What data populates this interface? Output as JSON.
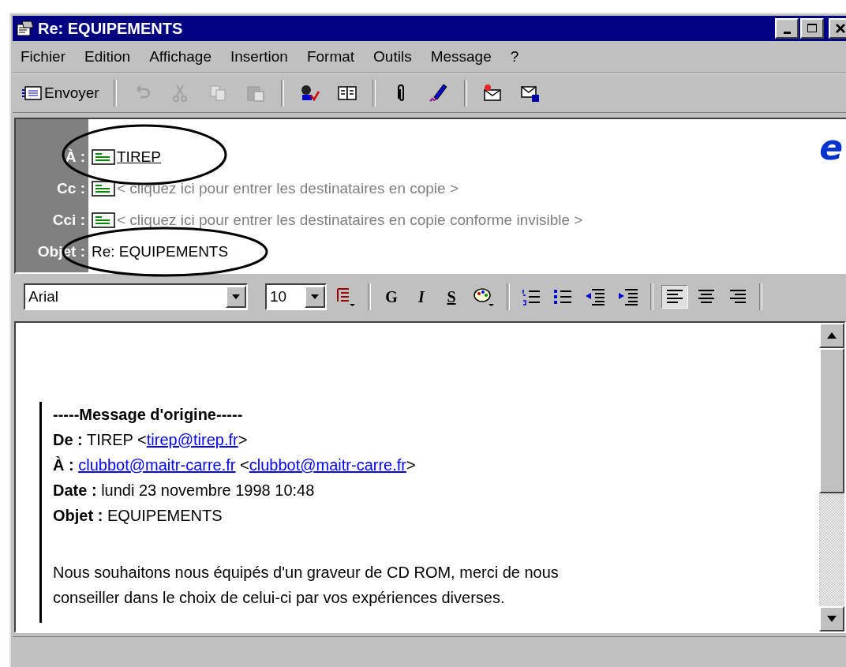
{
  "window": {
    "title": "Re: EQUIPEMENTS"
  },
  "menu": [
    {
      "label": "Fichier"
    },
    {
      "label": "Edition"
    },
    {
      "label": "Affichage"
    },
    {
      "label": "Insertion"
    },
    {
      "label": "Format"
    },
    {
      "label": "Outils"
    },
    {
      "label": "Message"
    },
    {
      "label": "?"
    }
  ],
  "toolbar": {
    "send": {
      "label": "Envoyer"
    },
    "buttons": [
      {
        "disabled": true
      },
      {
        "disabled": true
      },
      {
        "disabled": true
      },
      {
        "disabled": true
      },
      {
        "disabled": false
      },
      {
        "disabled": false
      },
      {
        "disabled": false
      },
      {
        "disabled": false
      },
      {
        "disabled": false
      },
      {
        "disabled": false
      }
    ]
  },
  "header": {
    "logo": "e",
    "to": {
      "label": "À :",
      "value": "TIREP"
    },
    "cc": {
      "label": "Cc :",
      "placeholder": "< cliquez ici pour entrer les destinataires en copie >"
    },
    "bcc": {
      "label": "Cci :",
      "placeholder": "< cliquez ici pour entrer les destinataires en copie conforme invisible >"
    },
    "subject": {
      "label": "Objet :",
      "value": "Re: EQUIPEMENTS"
    }
  },
  "format_bar": {
    "font": "Arial",
    "size": "10",
    "bold": "G",
    "italic": "I",
    "underline": "S",
    "align": [
      {
        "selected": true
      },
      {
        "selected": false
      },
      {
        "selected": false
      }
    ]
  },
  "message": {
    "title": "-----Message d'origine-----",
    "fields": [
      {
        "label": "De :",
        "parts": [
          {
            "text": "TIREP <"
          },
          {
            "link": "tirep@tirep.fr"
          },
          {
            "text": ">"
          }
        ]
      },
      {
        "label": "À :",
        "parts": [
          {
            "link": "clubbot@maitr-carre.fr"
          },
          {
            "text": " <"
          },
          {
            "link": "clubbot@maitr-carre.fr"
          },
          {
            "text": ">"
          }
        ]
      },
      {
        "label": "Date :",
        "parts": [
          {
            "text": "lundi 23 novembre 1998 10:48"
          }
        ]
      },
      {
        "label": "Objet :",
        "parts": [
          {
            "text": "EQUIPEMENTS"
          }
        ]
      }
    ],
    "body": [
      "Nous souhaitons nous équipés d'un graveur de CD ROM, merci de nous",
      "conseiller dans le choix de celui-ci par vos expériences diverses."
    ]
  }
}
